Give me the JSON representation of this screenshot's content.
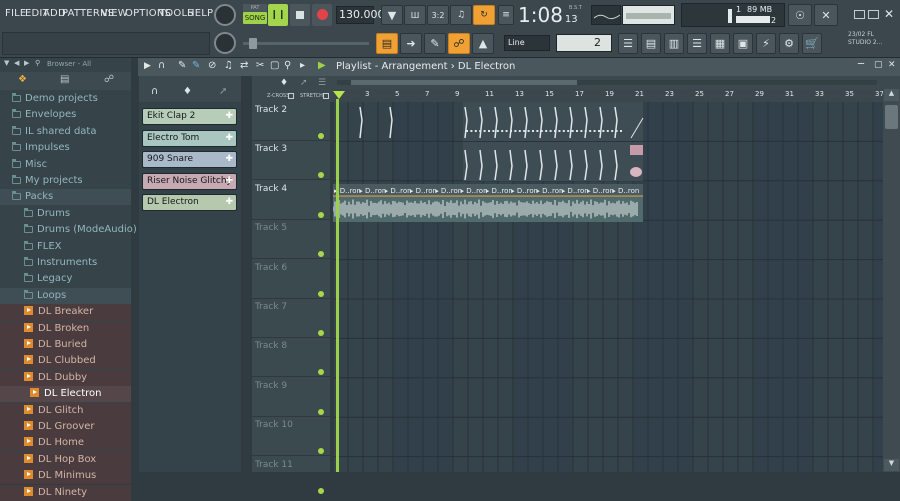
{
  "menu": [
    "FILE",
    "EDIT",
    "ADD",
    "PATTERNS",
    "VIEW",
    "OPTIONS",
    "TOOLS",
    "HELP"
  ],
  "transport": {
    "mode_label": "SONG",
    "tempo": "130.000",
    "time": "1:08",
    "time_small": "13",
    "bst_label": "B.S.T"
  },
  "monitor": {
    "memory": "89 MB",
    "cpu": "1",
    "voices": "2"
  },
  "version": {
    "date": "23/02",
    "name": "FL",
    "name2": "STUDIO 2..."
  },
  "snap": {
    "mode": "Line",
    "value": "2"
  },
  "browser": {
    "header": "Browser - All",
    "items": [
      {
        "label": "Demo projects",
        "type": "folder"
      },
      {
        "label": "Envelopes",
        "type": "folder"
      },
      {
        "label": "IL shared data",
        "type": "folder"
      },
      {
        "label": "Impulses",
        "type": "folder"
      },
      {
        "label": "Misc",
        "type": "folder"
      },
      {
        "label": "My projects",
        "type": "folder"
      },
      {
        "label": "Packs",
        "type": "folder-open"
      },
      {
        "label": "Drums",
        "type": "sub"
      },
      {
        "label": "Drums (ModeAudio)",
        "type": "sub"
      },
      {
        "label": "FLEX",
        "type": "sub"
      },
      {
        "label": "Instruments",
        "type": "sub"
      },
      {
        "label": "Legacy",
        "type": "sub"
      },
      {
        "label": "Loops",
        "type": "sub-open"
      },
      {
        "label": "DL Breaker",
        "type": "pattern"
      },
      {
        "label": "DL Broken",
        "type": "pattern"
      },
      {
        "label": "DL Buried",
        "type": "pattern"
      },
      {
        "label": "DL Clubbed",
        "type": "pattern"
      },
      {
        "label": "DL Dubby",
        "type": "pattern"
      },
      {
        "label": "DL Electron",
        "type": "pattern-selected"
      },
      {
        "label": "DL Glitch",
        "type": "pattern"
      },
      {
        "label": "DL Groover",
        "type": "pattern"
      },
      {
        "label": "DL Home",
        "type": "pattern"
      },
      {
        "label": "DL Hop Box",
        "type": "pattern"
      },
      {
        "label": "DL Minimus",
        "type": "pattern"
      },
      {
        "label": "DL Ninety",
        "type": "pattern"
      }
    ]
  },
  "channels": [
    {
      "name": "Ekit Clap 2",
      "color": "#b8cdb8"
    },
    {
      "name": "Electro Tom",
      "color": "#a9c6c0"
    },
    {
      "name": "909 Snare",
      "color": "#aab9c9"
    },
    {
      "name": "Riser Noise Glitchy",
      "color": "#c7a9b1"
    },
    {
      "name": "DL Electron",
      "color": "#b6c8ae"
    }
  ],
  "playlist": {
    "title_parts": [
      "Playlist",
      "Arrangement",
      "DL Electron"
    ],
    "zcross_label": "Z-CROSS",
    "stretch_label": "STRETCH",
    "tracks": [
      "Track 2",
      "Track 3",
      "Track 4",
      "Track 5",
      "Track 6",
      "Track 7",
      "Track 8",
      "Track 9",
      "Track 10",
      "Track 11"
    ],
    "ruler": [
      "3",
      "5",
      "7",
      "9",
      "11",
      "13",
      "15",
      "17",
      "19",
      "21",
      "23",
      "25",
      "27",
      "29",
      "31",
      "33",
      "35",
      "37"
    ],
    "clip_label": "D..ron"
  }
}
